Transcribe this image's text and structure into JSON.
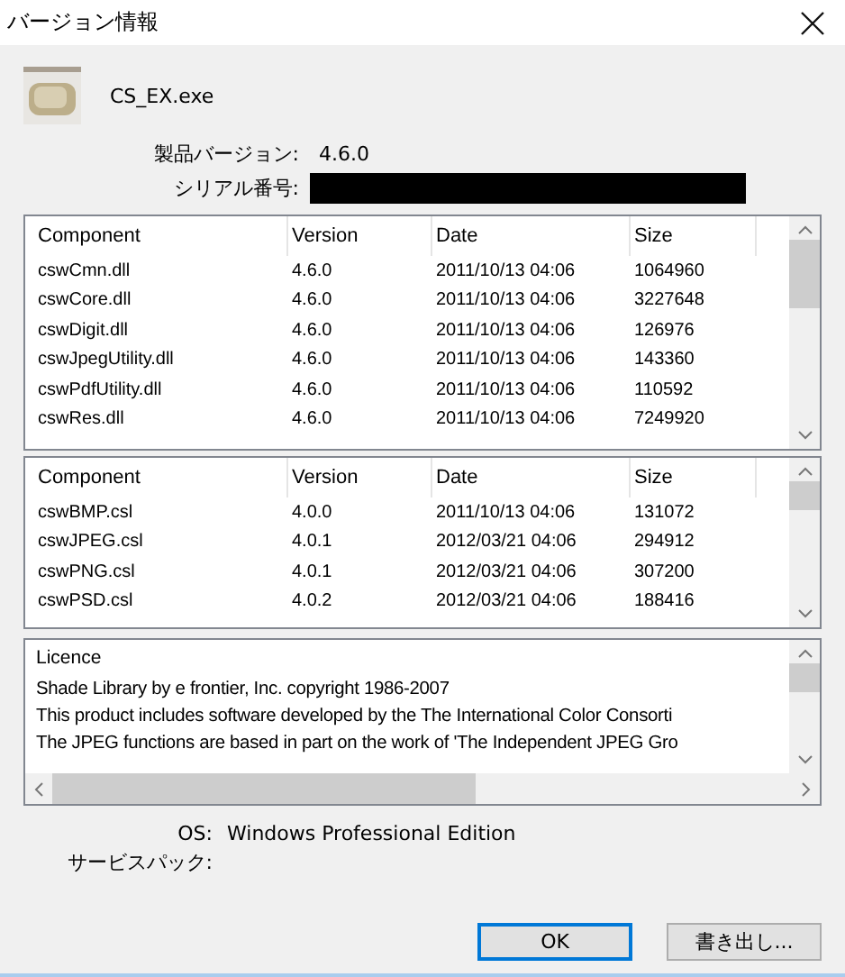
{
  "window": {
    "title": "バージョン情報"
  },
  "app": {
    "file_name": "CS_EX.exe"
  },
  "info": [
    {
      "label": "製品バージョン:",
      "value": "4.6.0",
      "kind": "text"
    },
    {
      "label": "シリアル番号:",
      "kind": "redacted"
    }
  ],
  "tables": [
    {
      "columns": [
        "Component",
        "Version",
        "Date",
        "Size"
      ],
      "rows": [
        [
          "cswCmn.dll",
          "4.6.0",
          "2011/10/13 04:06",
          "1064960"
        ],
        [
          "cswCore.dll",
          "4.6.0",
          "2011/10/13 04:06",
          "3227648"
        ],
        [
          "cswDigit.dll",
          "4.6.0",
          "2011/10/13 04:06",
          "126976"
        ],
        [
          "cswJpegUtility.dll",
          "4.6.0",
          "2011/10/13 04:06",
          "143360"
        ],
        [
          "cswPdfUtility.dll",
          "4.6.0",
          "2011/10/13 04:06",
          "110592"
        ],
        [
          "cswRes.dll",
          "4.6.0",
          "2011/10/13 04:06",
          "7249920"
        ]
      ]
    },
    {
      "columns": [
        "Component",
        "Version",
        "Date",
        "Size"
      ],
      "rows": [
        [
          "cswBMP.csl",
          "4.0.0",
          "2011/10/13 04:06",
          "131072"
        ],
        [
          "cswJPEG.csl",
          "4.0.1",
          "2012/03/21 04:06",
          "294912"
        ],
        [
          "cswPNG.csl",
          "4.0.1",
          "2012/03/21 04:06",
          "307200"
        ],
        [
          "cswPSD.csl",
          "4.0.2",
          "2012/03/21 04:06",
          "188416"
        ]
      ]
    }
  ],
  "licence": {
    "heading": "Licence",
    "lines": [
      "Shade Library by e frontier, Inc. copyright 1986-2007",
      "This product includes software developed by the The International Color Consorti",
      "The JPEG functions are based in part on the work of 'The Independent JPEG Gro"
    ]
  },
  "system": [
    {
      "label": "OS:",
      "value": "Windows Professional Edition"
    },
    {
      "label": "サービスパック:"
    }
  ],
  "buttons": [
    {
      "label": "OK",
      "selected": true
    },
    {
      "label": "書き出し...",
      "selected": false
    }
  ]
}
